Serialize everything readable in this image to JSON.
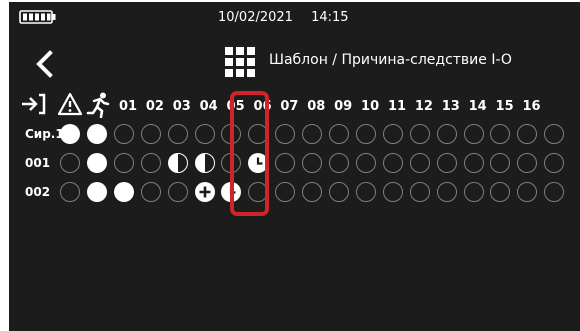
{
  "status_bar": {
    "battery_icon": "battery-full-icon",
    "date": "10/02/2021",
    "time": "14:15"
  },
  "header": {
    "back_icon": "chevron-left-icon",
    "grid_icon": "app-grid-icon",
    "breadcrumb": "Шаблон / Причина-следствие I-O"
  },
  "matrix": {
    "header_icons": [
      "input-arrow-icon",
      "warning-triangle-icon",
      "running-person-icon"
    ],
    "columns": [
      "01",
      "02",
      "03",
      "04",
      "05",
      "06",
      "07",
      "08",
      "09",
      "10",
      "11",
      "12",
      "13",
      "14",
      "15",
      "16"
    ],
    "highlighted_column": "05",
    "rows": [
      {
        "label": "Сир.1",
        "cells": [
          "filled",
          "filled",
          "empty",
          "empty",
          "empty",
          "empty",
          "empty",
          "empty",
          "empty",
          "empty",
          "empty",
          "empty",
          "empty",
          "empty",
          "empty",
          "empty",
          "empty",
          "empty",
          "empty"
        ]
      },
      {
        "label": "001",
        "cells": [
          "empty",
          "filled",
          "empty",
          "empty",
          "half",
          "half",
          "empty",
          "clock",
          "empty",
          "empty",
          "empty",
          "empty",
          "empty",
          "empty",
          "empty",
          "empty",
          "empty",
          "empty",
          "empty"
        ]
      },
      {
        "label": "002",
        "cells": [
          "empty",
          "filled",
          "filled",
          "empty",
          "empty",
          "plus",
          "clock",
          "empty",
          "empty",
          "empty",
          "empty",
          "empty",
          "empty",
          "empty",
          "empty",
          "empty",
          "empty",
          "empty",
          "empty"
        ]
      }
    ]
  },
  "colors": {
    "background": "#1c1c1c",
    "highlight": "#d2232a",
    "empty_ring": "#7f7f7f",
    "filled": "#ffffff"
  }
}
